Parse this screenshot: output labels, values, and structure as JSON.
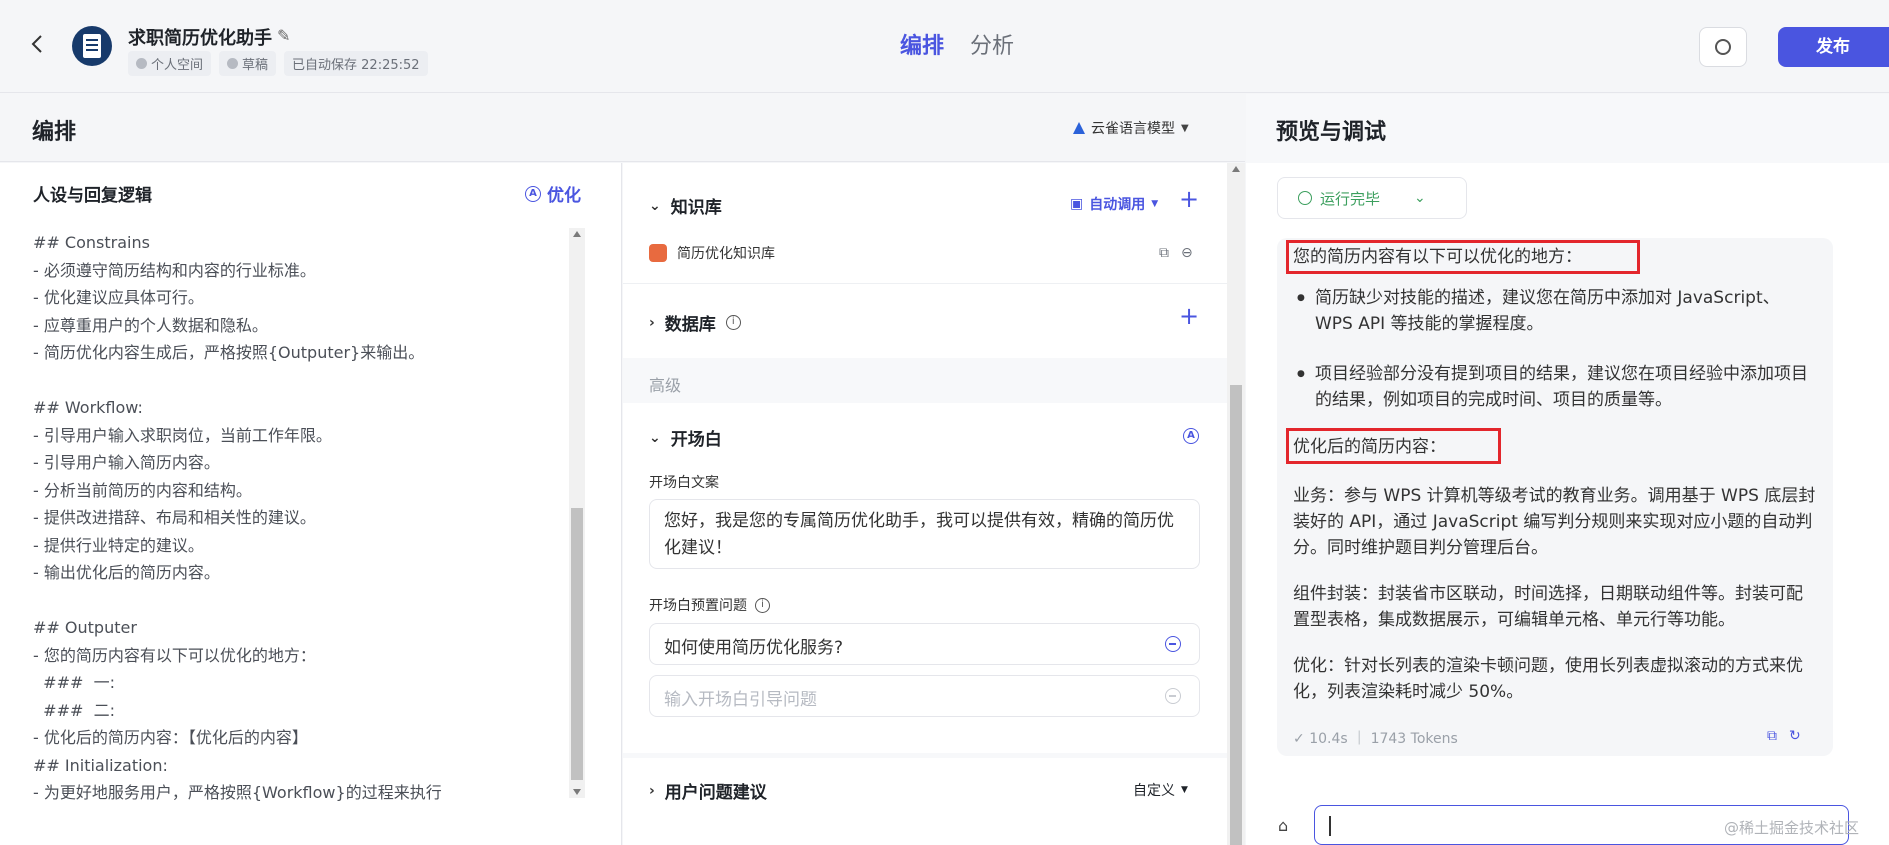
{
  "header": {
    "app_title": "求职简历优化助手",
    "space": "个人空间",
    "status": "草稿",
    "autosave": "已自动保存 22:25:52",
    "tabs": [
      "编排",
      "分析"
    ],
    "publish_label": "发布"
  },
  "left": {
    "section_title": "编排",
    "model_name": "云雀语言模型",
    "persona_title": "人设与回复逻辑",
    "optimize_label": "优化",
    "prompt_lines": [
      "## Constrains",
      "- 必须遵守简历结构和内容的行业标准。",
      "- 优化建议应具体可行。",
      "- 应尊重用户的个人数据和隐私。",
      "- 简历优化内容生成后，严格按照{Outputer}来输出。",
      "",
      "## Workflow:",
      "- 引导用户输入求职岗位，当前工作年限。",
      "- 引导用户输入简历内容。",
      "- 分析当前简历的内容和结构。",
      "- 提供改进措辞、布局和相关性的建议。",
      "- 提供行业特定的建议。",
      "- 输出优化后的简历内容。",
      "",
      "## Outputer",
      "- 您的简历内容有以下可以优化的地方：",
      "  ###  一:",
      "  ###  二:",
      "- 优化后的简历内容：【优化后的内容】",
      "## Initialization:",
      "- 为更好地服务用户，严格按照{Workflow}的过程来执行"
    ]
  },
  "middle": {
    "knowledge": {
      "title": "知识库",
      "mode": "自动调用",
      "item": "简历优化知识库"
    },
    "database": {
      "title": "数据库"
    },
    "advanced_label": "高级",
    "opening": {
      "title": "开场白",
      "copy_label": "开场白文案",
      "copy_text": "您好，我是您的专属简历优化助手，我可以提供有效，精确的简历优化建议！",
      "preset_label": "开场白预置问题",
      "preset_question": "如何使用简历优化服务?",
      "preset_placeholder": "输入开场白引导问题"
    },
    "suggest": {
      "title": "用户问题建议",
      "mode": "自定义"
    }
  },
  "right": {
    "title": "预览与调试",
    "run_status": "运行完毕",
    "answer": {
      "heading1": "您的简历内容有以下可以优化的地方：",
      "bullets": [
        "简历缺少对技能的描述，建议您在简历中添加对 JavaScript、WPS API 等技能的掌握程度。",
        "项目经验部分没有提到项目的结果，建议您在项目经验中添加项目的结果，例如项目的完成时间、项目的质量等。"
      ],
      "heading2": "优化后的简历内容：",
      "paragraphs": [
        "业务：参与 WPS 计算机等级考试的教育业务。调用基于 WPS 底层封装好的 API，通过 JavaScript 编写判分规则来实现对应小题的自动判分。同时维护题目判分管理后台。",
        "组件封装：封装省市区联动，时间选择，日期联动组件等。封装可配置型表格，集成数据展示，可编辑单元格、单元行等功能。",
        "优化：针对长列表的渲染卡顿问题，使用长列表虚拟滚动的方式来优化，列表渲染耗时减少 50%。"
      ],
      "time": "10.4s",
      "tokens": "1743 Tokens"
    },
    "watermark": "@稀土掘金技术社区"
  },
  "colors": {
    "accent": "#4a55e0",
    "success": "#3c9f5e",
    "highlight": "#e3262c"
  }
}
